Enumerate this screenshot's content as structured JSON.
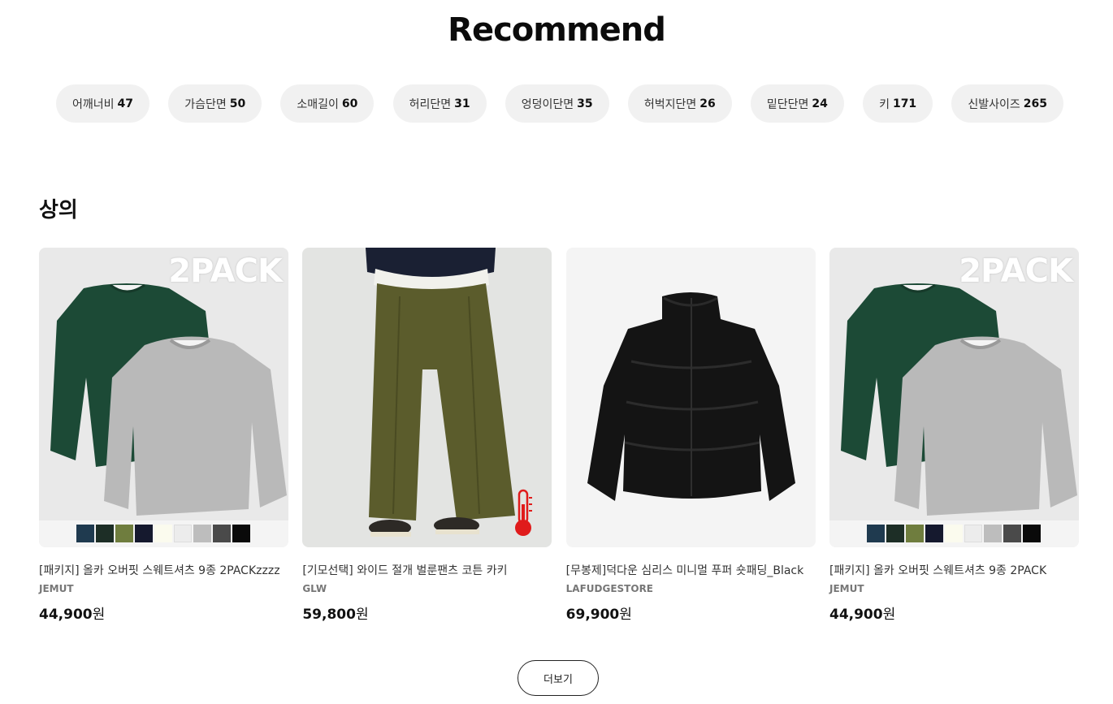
{
  "header": {
    "title": "Recommend"
  },
  "sizes": [
    {
      "label": "어깨너비",
      "value": "47"
    },
    {
      "label": "가슴단면",
      "value": "50"
    },
    {
      "label": "소매길이",
      "value": "60"
    },
    {
      "label": "허리단면",
      "value": "31"
    },
    {
      "label": "엉덩이단면",
      "value": "35"
    },
    {
      "label": "허벅지단면",
      "value": "26"
    },
    {
      "label": "밑단단면",
      "value": "24"
    },
    {
      "label": "키",
      "value": "171"
    },
    {
      "label": "신발사이즈",
      "value": "265"
    }
  ],
  "section": {
    "title": "상의"
  },
  "products": [
    {
      "name": "[패키지] 올카 오버핏 스웨트셔츠 9종 2PACKzzzz",
      "brand": "JEMUT",
      "price": "44,900",
      "currency": "원",
      "badge": "2PACK",
      "swatches": [
        "#1f3a4f",
        "#1d2e26",
        "#6f7d3e",
        "#15192e",
        "#fbfbee",
        "#ececec",
        "#bdbdbd",
        "#4a4a4a",
        "#0a0a0a"
      ]
    },
    {
      "name": "[기모선택] 와이드 절개 벌룬팬츠 코튼 카키",
      "brand": "GLW",
      "price": "59,800",
      "currency": "원",
      "icon": "thermometer-icon"
    },
    {
      "name": "[무봉제]덕다운 심리스 미니멀 푸퍼 숏패딩_Black",
      "brand": "LAFUDGESTORE",
      "price": "69,900",
      "currency": "원"
    },
    {
      "name": "[패키지] 올카 오버핏 스웨트셔츠 9종 2PACK",
      "brand": "JEMUT",
      "price": "44,900",
      "currency": "원",
      "badge": "2PACK",
      "swatches": [
        "#1f3a4f",
        "#1d2e26",
        "#6f7d3e",
        "#15192e",
        "#fbfbee",
        "#ececec",
        "#bdbdbd",
        "#4a4a4a",
        "#0a0a0a"
      ]
    }
  ],
  "more_button": {
    "label": "더보기"
  },
  "colors": {
    "chip_bg": "#f1f1f1",
    "thermometer": "#e01b1b"
  }
}
